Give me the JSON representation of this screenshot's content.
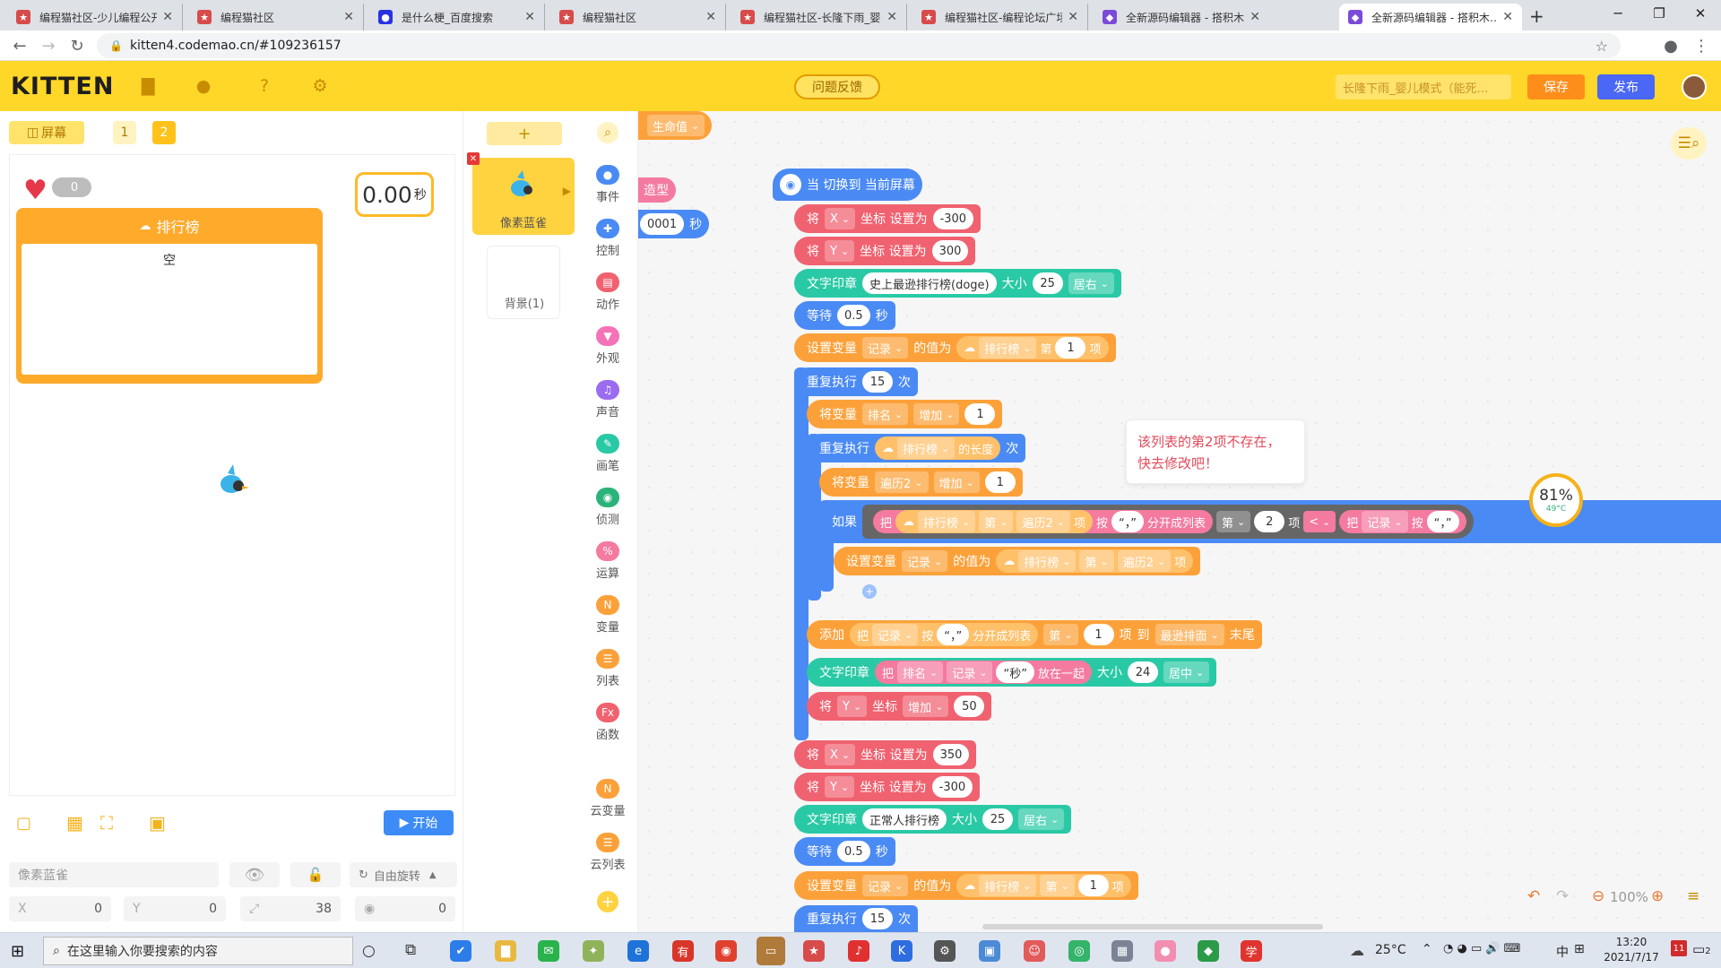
{
  "browser": {
    "tabs": [
      {
        "title": "编程猫社区-少儿编程公开…",
        "icon": "kitten-favicon",
        "color": "#d84b4b"
      },
      {
        "title": "编程猫社区",
        "icon": "kitten-favicon",
        "color": "#d84b4b"
      },
      {
        "title": "是什么梗_百度搜索",
        "icon": "baidu-favicon",
        "color": "#2932e1"
      },
      {
        "title": "编程猫社区",
        "icon": "kitten-favicon",
        "color": "#d84b4b"
      },
      {
        "title": "编程猫社区-长隆下雨_婴儿…",
        "icon": "kitten-favicon",
        "color": "#d84b4b"
      },
      {
        "title": "编程猫社区-编程论坛广场",
        "icon": "kitten-favicon",
        "color": "#d84b4b"
      },
      {
        "title": "全新源码编辑器 - 搭积木…",
        "icon": "codemao-favicon",
        "color": "#7b4bd8"
      },
      {
        "title": "全新源码编辑器 - 搭积木…",
        "icon": "codemao-favicon",
        "color": "#7b4bd8"
      }
    ],
    "url": "kitten4.codemao.cn/#109236157"
  },
  "header": {
    "logo": "KITTEN",
    "feedback": "问题反馈",
    "project_name": "长隆下雨_婴儿模式（能死…",
    "save": "保存",
    "publish": "发布",
    "brand_color": "#ffd728"
  },
  "stage": {
    "screen_label": "屏幕",
    "screen_tabs": [
      "1",
      "2"
    ],
    "heart_value": "0",
    "timer_value": "0.00",
    "timer_unit": "秒",
    "board_title": "排行榜",
    "board_empty": "空",
    "start": "开始",
    "sprite_name": "像素蓝雀",
    "rotation": "自由旋转",
    "x_label": "X",
    "x_value": "0",
    "y_label": "Y",
    "y_value": "0",
    "size_value": "38",
    "angle_value": "0"
  },
  "sprites": {
    "add": "+",
    "current": "像素蓝雀",
    "background": "背景(1)"
  },
  "categories": [
    {
      "label": "事件",
      "color": "#4a8af4"
    },
    {
      "label": "控制",
      "color": "#4a8af4"
    },
    {
      "label": "动作",
      "color": "#f06270"
    },
    {
      "label": "外观",
      "color": "#f472b6"
    },
    {
      "label": "声音",
      "color": "#9a6cf0"
    },
    {
      "label": "画笔",
      "color": "#2ac9a5"
    },
    {
      "label": "侦测",
      "color": "#2ab37a"
    },
    {
      "label": "运算",
      "color": "#f47aa0"
    },
    {
      "label": "变量",
      "color": "#fca13a"
    },
    {
      "label": "列表",
      "color": "#fca13a"
    },
    {
      "label": "函数",
      "color": "#f06270"
    },
    {
      "label": "云变量",
      "color": "#fca13a"
    },
    {
      "label": "云列表",
      "color": "#fca13a"
    }
  ],
  "workspace": {
    "partial": {
      "life": "生命值",
      "shape": "造型",
      "num": "0001",
      "sec": "秒"
    },
    "hat": "当 切换到 当前屏幕",
    "tooltip": "该列表的第2项不存在，快去修改吧！",
    "gauge_pct": "81%",
    "gauge_temp": "49°C",
    "zoom": "100%",
    "b": {
      "set": "将",
      "x": "X",
      "y": "Y",
      "coord_set": "坐标 设置为",
      "coord_add": "坐标",
      "inc": "增加",
      "x1": "-300",
      "y1": "300",
      "stamp": "文字印章",
      "stamp_text1": "史上最逊排行榜(doge)",
      "size": "大小",
      "size1": "25",
      "align_right": "居右",
      "wait": "等待",
      "wait_v": "0.5",
      "sec": "秒",
      "setvar": "设置变量",
      "rec": "记录",
      "valueof": "的值为",
      "list": "排行榜",
      "nth": "第",
      "item": "项",
      "one": "1",
      "repeat": "重复执行",
      "times": "15",
      "times_u": "次",
      "var": "将变量",
      "rank": "排名",
      "add": "增加",
      "length": "的长度",
      "iter": "遍历2",
      "if": "如果",
      "take": "把",
      "by": "按",
      "comma": "“，”",
      "split": "分开成列表",
      "two": "2",
      "lt": "<",
      "append": "添加",
      "to": "到",
      "worst": "最逊排面",
      "end": "末尾",
      "join": "放在一起",
      "secstr": "“秒”",
      "size24": "24",
      "center": "居中",
      "y50": "50",
      "x2": "350",
      "y2": "-300",
      "stamp_text2": "正常人排行榜",
      "size2": "25"
    }
  },
  "taskbar": {
    "search": "在这里输入你要搜索的内容",
    "temp": "25°C",
    "ime": "中",
    "time": "13:20",
    "date": "2021/7/17",
    "notif": "2"
  }
}
